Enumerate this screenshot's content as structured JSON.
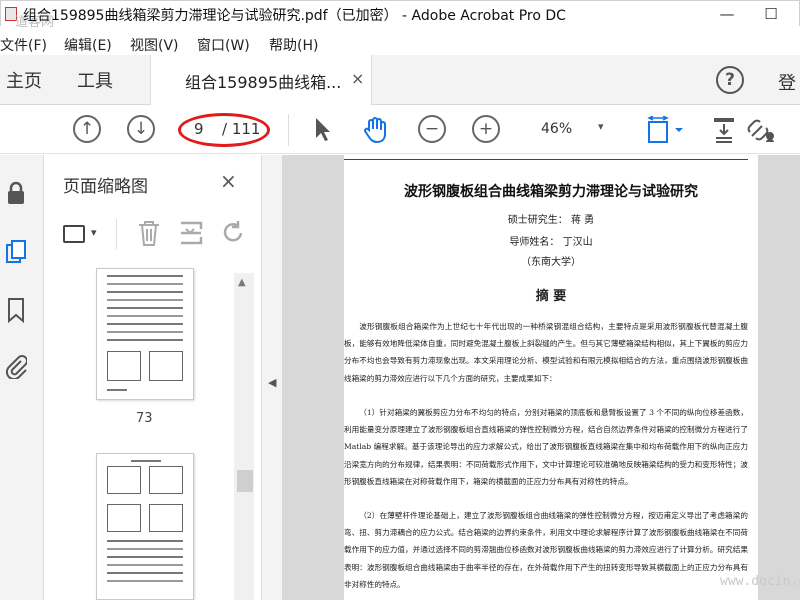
{
  "window": {
    "title": "组合159895曲线箱梁剪力滞理论与试验研究.pdf（已加密） - Adobe Acrobat Pro DC",
    "watermark_logo": "道客网",
    "minimize_glyph": "—",
    "maximize_glyph": "☐"
  },
  "menu": [
    "文件(F)",
    "编辑(E)",
    "视图(V)",
    "窗口(W)",
    "帮助(H)"
  ],
  "tabs": {
    "home": "主页",
    "tools": "工具",
    "document": "组合159895曲线箱...",
    "close_glyph": "×",
    "help_glyph": "?",
    "login": "登"
  },
  "toolbar": {
    "prev_glyph": "↑",
    "next_glyph": "↓",
    "page_current": "9",
    "page_total": "/ 111",
    "zoom_out_glyph": "−",
    "zoom_in_glyph": "+",
    "zoom": "46%",
    "zoom_caret": "▾"
  },
  "thumbnails_panel": {
    "title": "页面缩略图",
    "close_glyph": "×",
    "page_label": "73"
  },
  "document": {
    "title": "波形钢腹板组合曲线箱梁剪力滞理论与试验研究",
    "author": "硕士研究生： 蒋 勇",
    "advisor": "导师姓名： 丁汉山",
    "school": "（东南大学）",
    "abstract_heading": "摘 要",
    "para1": "波形钢腹板组合箱梁作为上世纪七十年代出现的一种桥梁钢混组合结构，主要特点是采用波形钢腹板代替混凝土腹板，能够有效地降低梁体自重，同时避免混凝土腹板上斜裂缝的产生。但与其它薄壁箱梁结构相似，其上下翼板的剪应力分布不均也会导致有剪力滞现象出现。本文采用理论分析、模型试验和有限元模拟相结合的方法，重点围绕波形钢腹板曲线箱梁的剪力滞效应进行以下几个方面的研究，主要成果如下：",
    "para2": "（1）针对箱梁的翼板剪应力分布不均匀的特点，分别对箱梁的顶底板和悬臂板设置了 3 个不同的纵向位移差函数，利用能量变分原理建立了波形钢腹板组合直线箱梁的弹性控制微分方程，结合自然边界条件对箱梁的控制微分方程进行了 Matlab 编程求解。基于该理论导出的应力求解公式，给出了波形钢腹板直线箱梁在集中和均布荷载作用下的纵向正应力沿梁宽方向的分布规律，结果表明：不同荷载形式作用下，文中计算理论可较准确地反映箱梁结构的受力和变形特性；波形钢腹板直线箱梁在对称荷载作用下，箱梁的横截面的正应力分布具有对称性的特点。",
    "para3": "（2）在薄壁杆件理论基础上，建立了波形钢腹板组合曲线箱梁的弹性控制微分方程，按迈甫定义导出了考虑箱梁的弯、扭、剪力滞耦合的应力公式。结合箱梁的边界约束条件，利用文中理论求解程序计算了波形钢腹板曲线箱梁在不同荷载作用下的应力值，并通过选择不同的剪滞翘曲位移函数对波形钢腹板曲线箱梁的剪力滞效应进行了计算分析。研究结果表明：波形钢腹板组合曲线箱梁由于曲率半径的存在，在外荷载作用下产生的扭转变形导致其横截面上的正应力分布具有非对称性的特点。"
  },
  "watermark_url": "www.docin.com",
  "colors": {
    "annotation_circle": "#e01b1b",
    "toolbar_bg": "#f3f3f3",
    "doc_bg": "#d8d8d8"
  }
}
